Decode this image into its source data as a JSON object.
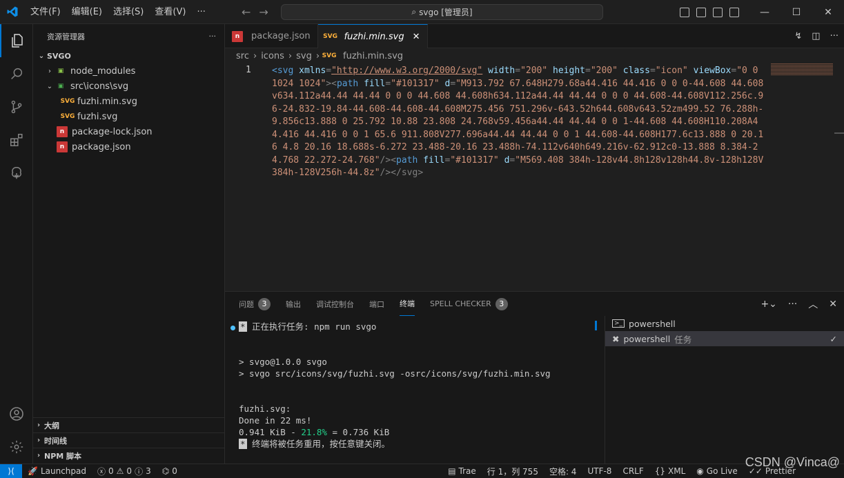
{
  "titlebar": {
    "menu": [
      "文件(F)",
      "编辑(E)",
      "选择(S)",
      "查看(V)",
      "···"
    ],
    "search_text": "svgo [管理员]"
  },
  "sidebar": {
    "title": "资源管理器",
    "more": "···",
    "root": "SVGO",
    "items": [
      {
        "label": "node_modules",
        "type": "folder",
        "icon": "node-folder-icon"
      },
      {
        "label": "src\\icons\\svg",
        "type": "folder-open",
        "icon": "src-folder-icon"
      },
      {
        "label": "fuzhi.min.svg",
        "type": "svg",
        "icon": "svg-file-icon"
      },
      {
        "label": "fuzhi.svg",
        "type": "svg",
        "icon": "svg-file-icon"
      },
      {
        "label": "package-lock.json",
        "type": "npm",
        "icon": "npm-file-icon"
      },
      {
        "label": "package.json",
        "type": "npm",
        "icon": "npm-file-icon"
      }
    ],
    "sections": [
      "大纲",
      "时间线",
      "NPM 脚本"
    ]
  },
  "tabs": [
    {
      "label": "package.json",
      "active": false
    },
    {
      "label": "fuzhi.min.svg",
      "active": true,
      "close": "✕"
    }
  ],
  "breadcrumb": [
    "src",
    "icons",
    "svg",
    "fuzhi.min.svg"
  ],
  "editor": {
    "line_number": "1",
    "code": {
      "t1": "<svg",
      "a_xmlns": "xmlns",
      "eq": "=",
      "v_xmlns": "\"http://www.w3.org/2000/svg\"",
      "a_width": "width",
      "v_width": "\"200\"",
      "a_height": "height",
      "v_height": "\"200\"",
      "a_class": "class",
      "v_class": "\"icon\"",
      "a_viewbox": "viewBox",
      "v_viewbox": "\"0 0 1024 1024\"",
      "gt_lt": "><",
      "t_path": "path",
      "a_fill": "fill",
      "v_fill": "\"#101317\"",
      "a_d": "d",
      "v_d1": "\"M913.792 67.648H279.68a44.416 44.416 0 0 0-44.608 44.608v634.112a44.44 44.44 0 0 0 44.608 44.608h634.112a44.44 44.44 0 0 0 44.608-44.608V112.256c.96-24.832-19.84-44.608-44.608-44.608M275.456 751.296v-643.52h644.608v643.52zm499.52 76.288h-9.856c13.888 0 25.792 10.88 23.808 24.768v59.456a44.44 44.44 0 0 1-44.608 44.608H110.208A44.416 44.416 0 0 1 65.6 911.808V277.696a44.44 44.44 0 0 1 44.608-44.608H177.6c13.888 0 20.16 4.8 20.16 18.688s-6.272 23.488-20.16 23.488h-74.112v640h649.216v-62.912c0-13.888 8.384-24.768 22.272-24.768\"",
      "close1": "/><",
      "v_d2": "\"M569.408 384h-128v44.8h128v128h44.8v-128h128V384h-128V256h-44.8z\"",
      "end": "/></svg>"
    }
  },
  "panel": {
    "tabs": [
      {
        "label": "问题",
        "badge": "3"
      },
      {
        "label": "输出"
      },
      {
        "label": "调试控制台"
      },
      {
        "label": "端口"
      },
      {
        "label": "终端",
        "active": true
      },
      {
        "label": "SPELL CHECKER",
        "badge": "3"
      }
    ],
    "terminal": {
      "task_marker": "*",
      "task_line": " 正在执行任务: npm run svgo",
      "cmd1": "> svgo@1.0.0 svgo",
      "cmd2": "> svgo src/icons/svg/fuzhi.svg -osrc/icons/svg/fuzhi.min.svg",
      "file": "fuzhi.svg:",
      "done": "Done in 22 ms!",
      "size_a": "0.941 KiB - ",
      "percent": "21.8%",
      "size_b": " = 0.736 KiB",
      "end_marker": "*",
      "end_line": " 终端将被任务重用，按任意键关闭。"
    },
    "terminals": [
      {
        "label": "powershell",
        "suffix": ""
      },
      {
        "label": "powershell",
        "suffix": "任务",
        "selected": true
      }
    ]
  },
  "statusbar": {
    "launchpad": "Launchpad",
    "errors": "0",
    "warnings": "0",
    "info": "3",
    "ports": "0",
    "trae": "Trae",
    "position": "行 1，列 755",
    "spaces": "空格: 4",
    "encoding": "UTF-8",
    "eol": "CRLF",
    "language": "XML",
    "golive": "Go Live",
    "prettier": "Prettier"
  },
  "watermark": "CSDN @Vinca@",
  "colors": {
    "accent": "#0078d4",
    "npm": "#cb3837",
    "svg": "#ffb13b"
  }
}
